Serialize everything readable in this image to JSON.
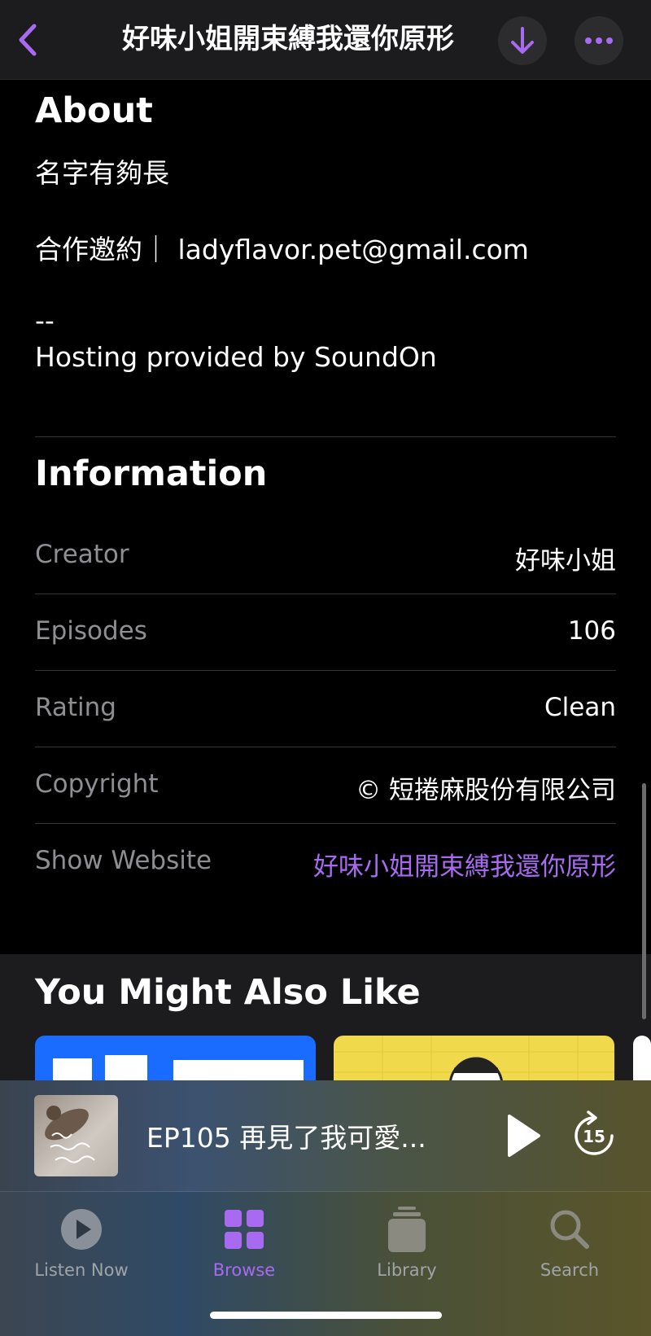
{
  "nav": {
    "title": "好味小姐開束縛我還你原形"
  },
  "about": {
    "heading": "About",
    "lines": [
      "名字有夠長",
      "合作邀約｜ ladyflavor.pet@gmail.com",
      "--",
      "Hosting provided by SoundOn"
    ]
  },
  "information": {
    "heading": "Information",
    "rows": [
      {
        "label": "Creator",
        "value": "好味小姐"
      },
      {
        "label": "Episodes",
        "value": "106"
      },
      {
        "label": "Rating",
        "value": "Clean"
      },
      {
        "label": "Copyright",
        "value": "© 短捲麻股份有限公司"
      },
      {
        "label": "Show Website",
        "value": "好味小姐開束縛我還你原形"
      }
    ]
  },
  "suggestions": {
    "heading": "You Might Also Like"
  },
  "mini_player": {
    "episode_title": "EP105 再見了我可愛...",
    "skip_seconds": "15"
  },
  "tabs": [
    {
      "label": "Listen Now",
      "icon": "play-circle-icon"
    },
    {
      "label": "Browse",
      "icon": "grid-icon"
    },
    {
      "label": "Library",
      "icon": "library-stack-icon"
    },
    {
      "label": "Search",
      "icon": "search-icon"
    }
  ],
  "colors": {
    "accent": "#a76af0",
    "background": "#000000",
    "secondary_text": "#8e8e93"
  }
}
